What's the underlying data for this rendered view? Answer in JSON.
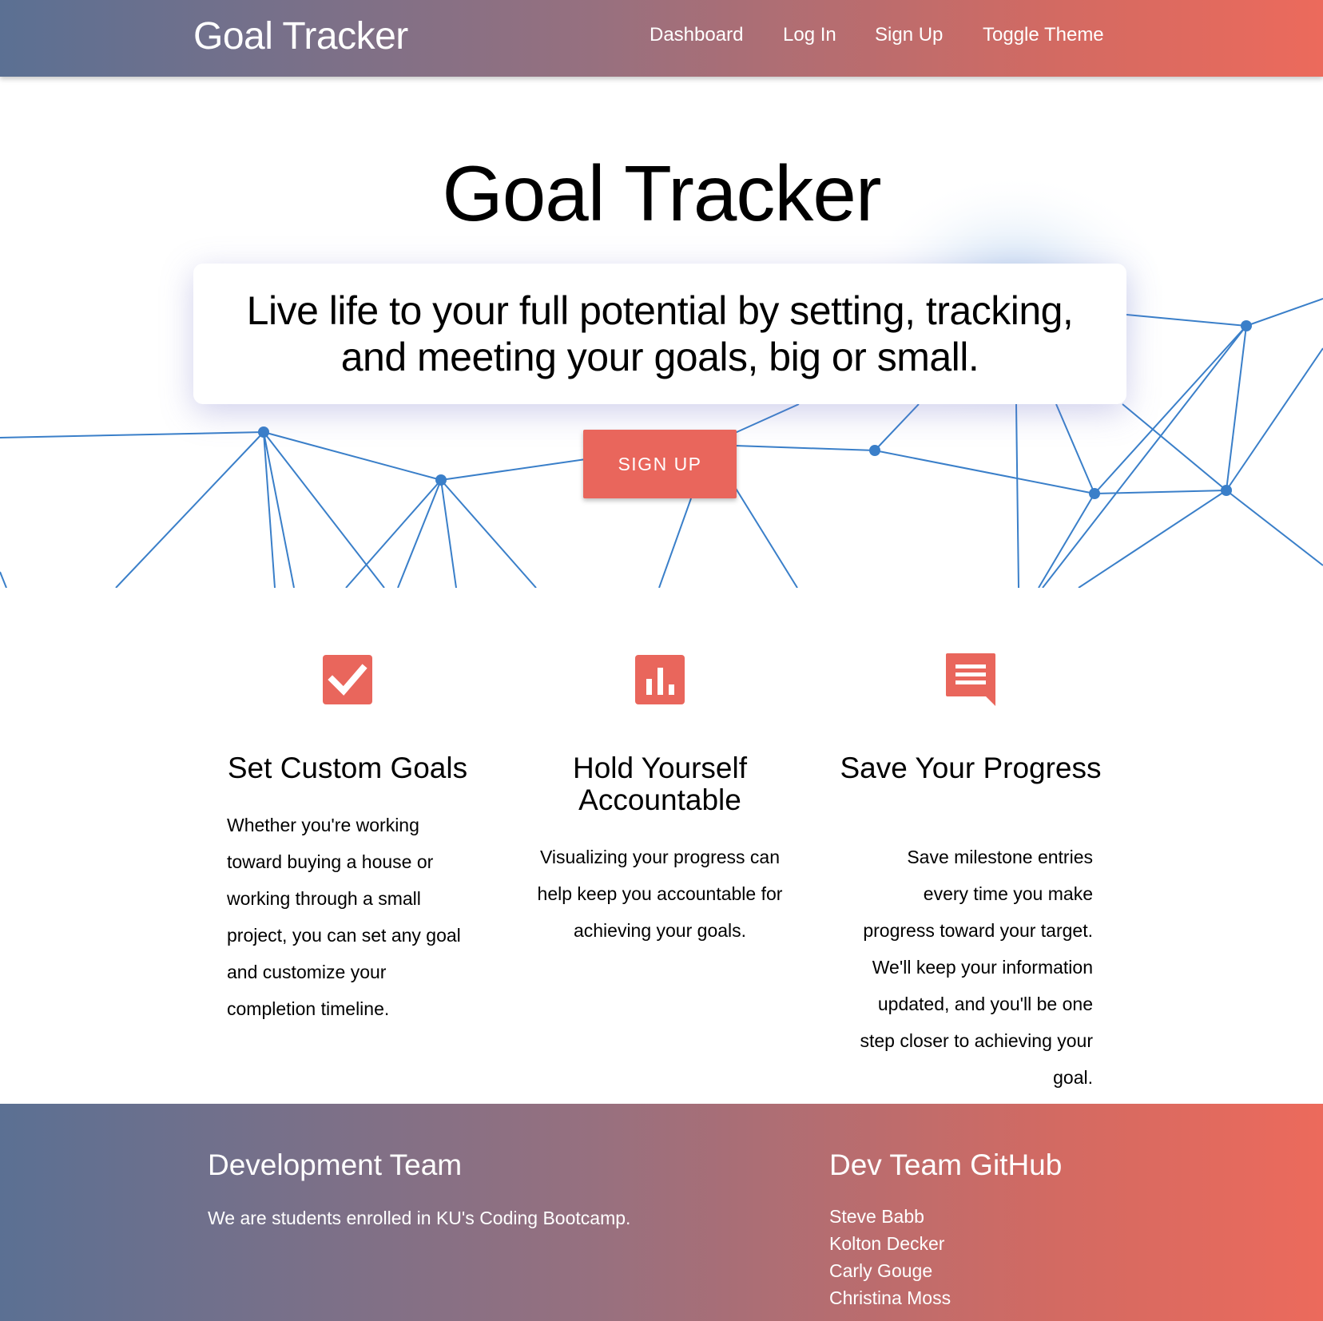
{
  "nav": {
    "brand": "Goal Tracker",
    "links": [
      "Dashboard",
      "Log In",
      "Sign Up",
      "Toggle Theme"
    ]
  },
  "hero": {
    "title": "Goal Tracker",
    "tagline": "Live life to your full potential by setting, tracking, and meeting your goals, big or small.",
    "cta": "SIGN UP"
  },
  "features": [
    {
      "icon": "checkbox-icon",
      "title": "Set Custom Goals",
      "text": "Whether you're working toward buying a house or working through a small project, you can set any goal and customize your completion timeline."
    },
    {
      "icon": "bar-chart-icon",
      "title": "Hold Yourself Accountable",
      "text": "Visualizing your progress can help keep you accountable for achieving your goals."
    },
    {
      "icon": "comment-icon",
      "title": "Save Your Progress",
      "text": "Save milestone entries every time you make progress toward your target. We'll keep your information updated, and you'll be one step closer to achieving your goal."
    }
  ],
  "footer": {
    "team_heading": "Development Team",
    "team_text": "We are students enrolled in KU's Coding Bootcamp.",
    "github_heading": "Dev Team GitHub",
    "members": [
      "Steve Babb",
      "Kolton Decker",
      "Carly Gouge",
      "Christina Moss"
    ]
  },
  "colors": {
    "accent": "#e9665c",
    "gradient_start": "#5b7093",
    "gradient_end": "#ec6a5c",
    "network_line": "#3a7fc9"
  }
}
